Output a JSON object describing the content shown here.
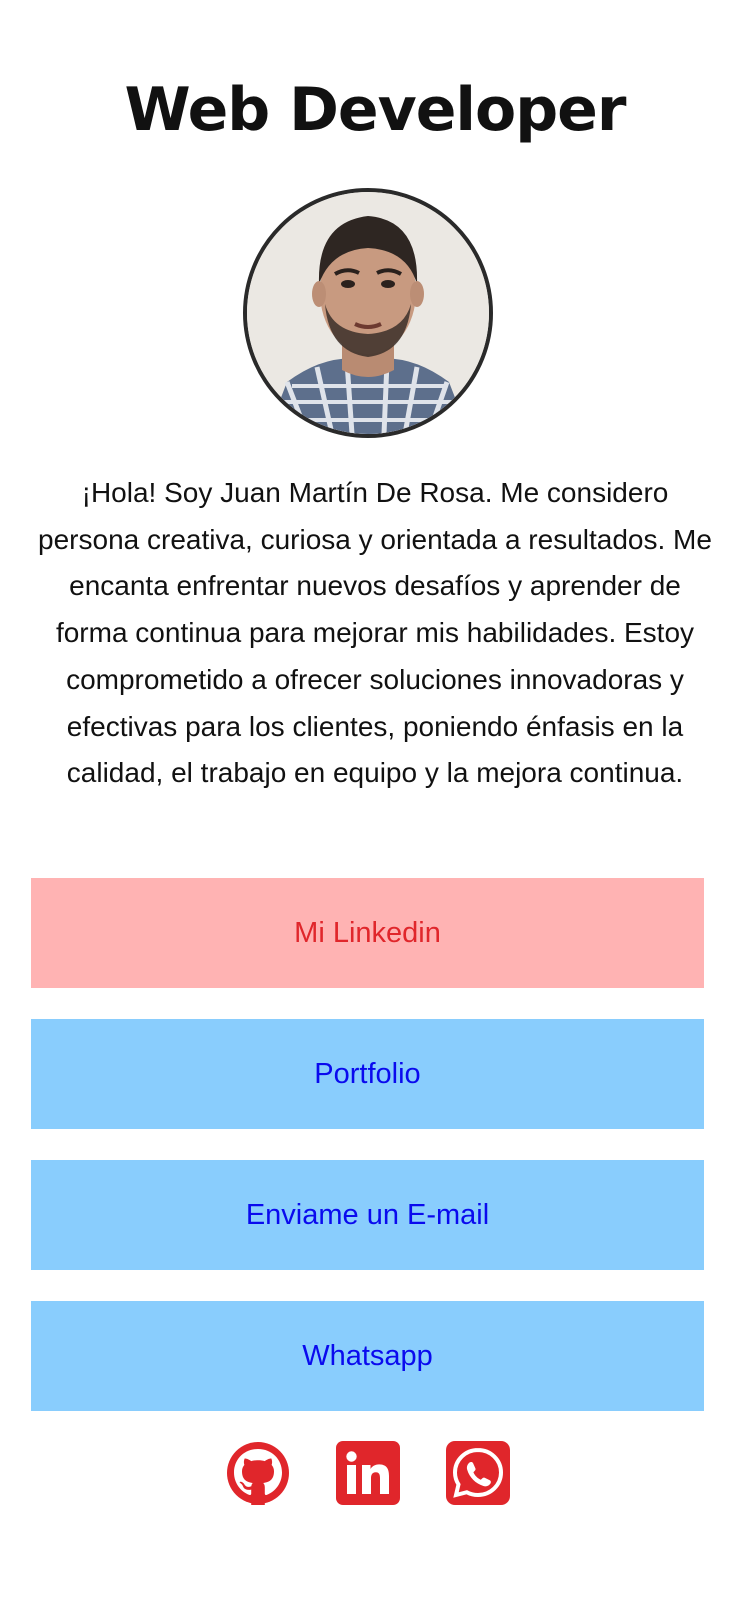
{
  "header": {
    "title": "Web Developer"
  },
  "profile": {
    "photo_alt": "Juan Martín De Rosa",
    "bio": "¡Hola! Soy Juan Martín De Rosa. Me considero persona creativa, curiosa y orientada a resultados. Me encanta enfrentar nuevos desafíos y aprender de forma continua para mejorar mis habilidades. Estoy comprometido a ofrecer soluciones innovadoras y efectivas para los clientes, poniendo énfasis en la calidad, el trabajo en equipo y la mejora continua."
  },
  "links": [
    {
      "label": "Mi Linkedin"
    },
    {
      "label": "Portfolio"
    },
    {
      "label": "Enviame un E-mail"
    },
    {
      "label": "Whatsapp"
    }
  ],
  "social": [
    {
      "icon": "github-icon"
    },
    {
      "icon": "linkedin-icon"
    },
    {
      "icon": "whatsapp-icon"
    }
  ],
  "colors": {
    "accent_red": "#e0262b",
    "linkedin_bg": "#ffb3b3",
    "button_bg": "#89cdfd",
    "button_text": "#0a0aee"
  }
}
